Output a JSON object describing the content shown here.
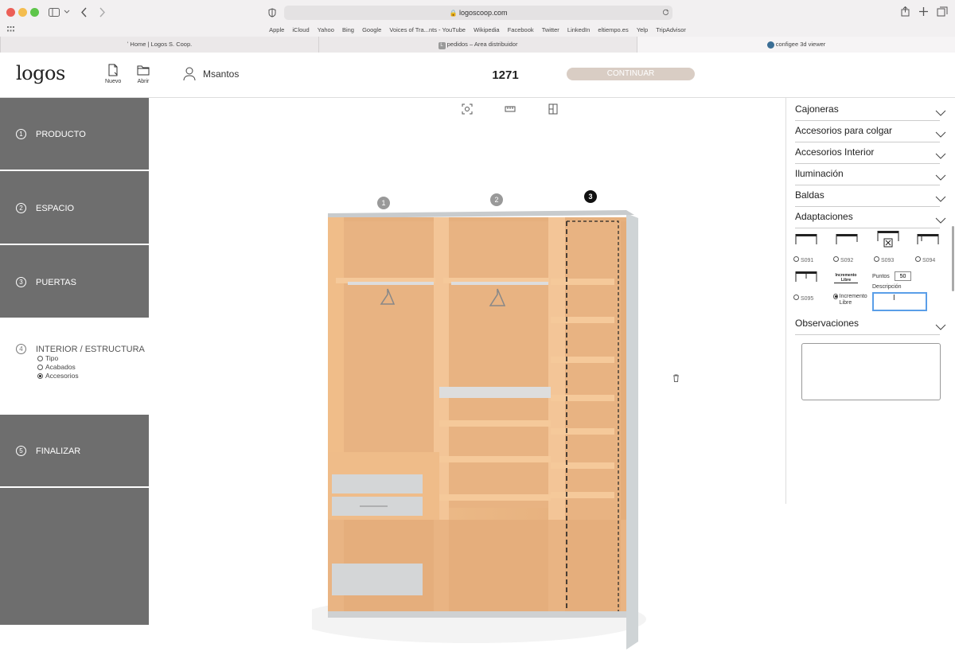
{
  "browser": {
    "url": "logoscoop.com",
    "favorites": [
      "Apple",
      "iCloud",
      "Yahoo",
      "Bing",
      "Google",
      "Voices of Tra...nts - YouTube",
      "Wikipedia",
      "Facebook",
      "Twitter",
      "LinkedIn",
      "eltiempo.es",
      "Yelp",
      "TripAdvisor"
    ],
    "tabs": [
      {
        "label": "Home | Logos S. Coop."
      },
      {
        "label": "pedidos – Area distribuidor"
      },
      {
        "label": "configee 3d viewer"
      }
    ]
  },
  "header": {
    "logo": "logos",
    "nuevo": "Nuevo",
    "abrir": "Abrir",
    "user": "Msantos",
    "order_number": "1271",
    "continue": "CONTINUAR"
  },
  "steps": [
    {
      "num": "1",
      "label": "PRODUCTO"
    },
    {
      "num": "2",
      "label": "ESPACIO"
    },
    {
      "num": "3",
      "label": "PUERTAS"
    },
    {
      "num": "4",
      "label": "INTERIOR / ESTRUCTURA",
      "subitems": [
        {
          "label": "Tipo",
          "selected": false
        },
        {
          "label": "Acabados",
          "selected": false
        },
        {
          "label": "Accesorios",
          "selected": true
        }
      ]
    },
    {
      "num": "5",
      "label": "FINALIZAR"
    }
  ],
  "viewer": {
    "module_labels": [
      "1",
      "2",
      "3"
    ],
    "selected_module": "3"
  },
  "panel": {
    "sections": [
      "Cajoneras",
      "Accesorios para colgar",
      "Accesorios Interior",
      "Iluminación",
      "Baldas",
      "Adaptaciones"
    ],
    "adaptations": [
      {
        "code": "S091",
        "selected": false
      },
      {
        "code": "S092",
        "selected": false
      },
      {
        "code": "S093",
        "selected": false
      },
      {
        "code": "S094",
        "selected": false
      },
      {
        "code": "S095",
        "selected": false
      },
      {
        "code": "Incremento Libre",
        "selected": true
      }
    ],
    "incremento_thumb_label": "Incremento Libre",
    "puntos_label": "Puntos",
    "puntos_value": "50",
    "descripcion_label": "Descripción",
    "observaciones": "Observaciones"
  }
}
